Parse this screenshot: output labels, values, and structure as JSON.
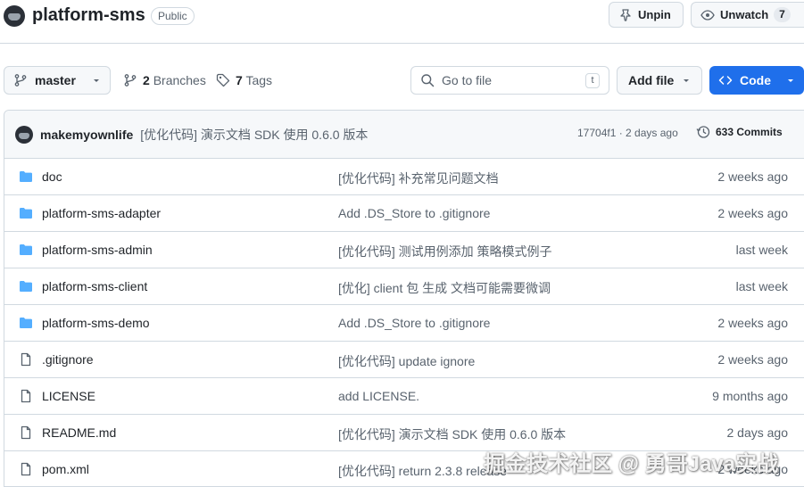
{
  "repo": {
    "name": "platform-sms",
    "visibility": "Public",
    "unpin_label": "Unpin",
    "unwatch_label": "Unwatch",
    "watch_count": "7"
  },
  "toolbar": {
    "branch": "master",
    "branches_count": "2",
    "branches_label": "Branches",
    "tags_count": "7",
    "tags_label": "Tags",
    "goto_placeholder": "Go to file",
    "goto_shortcut": "t",
    "add_file_label": "Add file",
    "code_label": "Code"
  },
  "latest_commit": {
    "author": "makemyownlife",
    "message": "[优化代码] 演示文档 SDK 使用 0.6.0 版本",
    "meta": "17704f1 · 2 days ago",
    "commits_label": "633 Commits"
  },
  "files": [
    {
      "name": "doc",
      "type": "folder",
      "commit": "[优化代码] 补充常见问题文档",
      "age": "2 weeks ago"
    },
    {
      "name": "platform-sms-adapter",
      "type": "folder",
      "commit": "Add .DS_Store to .gitignore",
      "age": "2 weeks ago"
    },
    {
      "name": "platform-sms-admin",
      "type": "folder",
      "commit": "[优化代码] 测试用例添加 策略模式例子",
      "age": "last week"
    },
    {
      "name": "platform-sms-client",
      "type": "folder",
      "commit": "[优化] client 包 生成 文档可能需要微调",
      "age": "last week"
    },
    {
      "name": "platform-sms-demo",
      "type": "folder",
      "commit": "Add .DS_Store to .gitignore",
      "age": "2 weeks ago"
    },
    {
      "name": ".gitignore",
      "type": "file",
      "commit": "[优化代码] update ignore",
      "age": "2 weeks ago"
    },
    {
      "name": "LICENSE",
      "type": "file",
      "commit": "add LICENSE.",
      "age": "9 months ago"
    },
    {
      "name": "README.md",
      "type": "file",
      "commit": "[优化代码] 演示文档 SDK 使用 0.6.0 版本",
      "age": "2 days ago"
    },
    {
      "name": "pom.xml",
      "type": "file",
      "commit": "[优化代码] return 2.3.8 release",
      "age": "2 weeks ago"
    }
  ],
  "watermark": "掘金技术社区 @ 勇哥Java实战",
  "colors": {
    "accent": "#1f6feb",
    "folder": "#54aeff",
    "muted": "#59636e"
  }
}
